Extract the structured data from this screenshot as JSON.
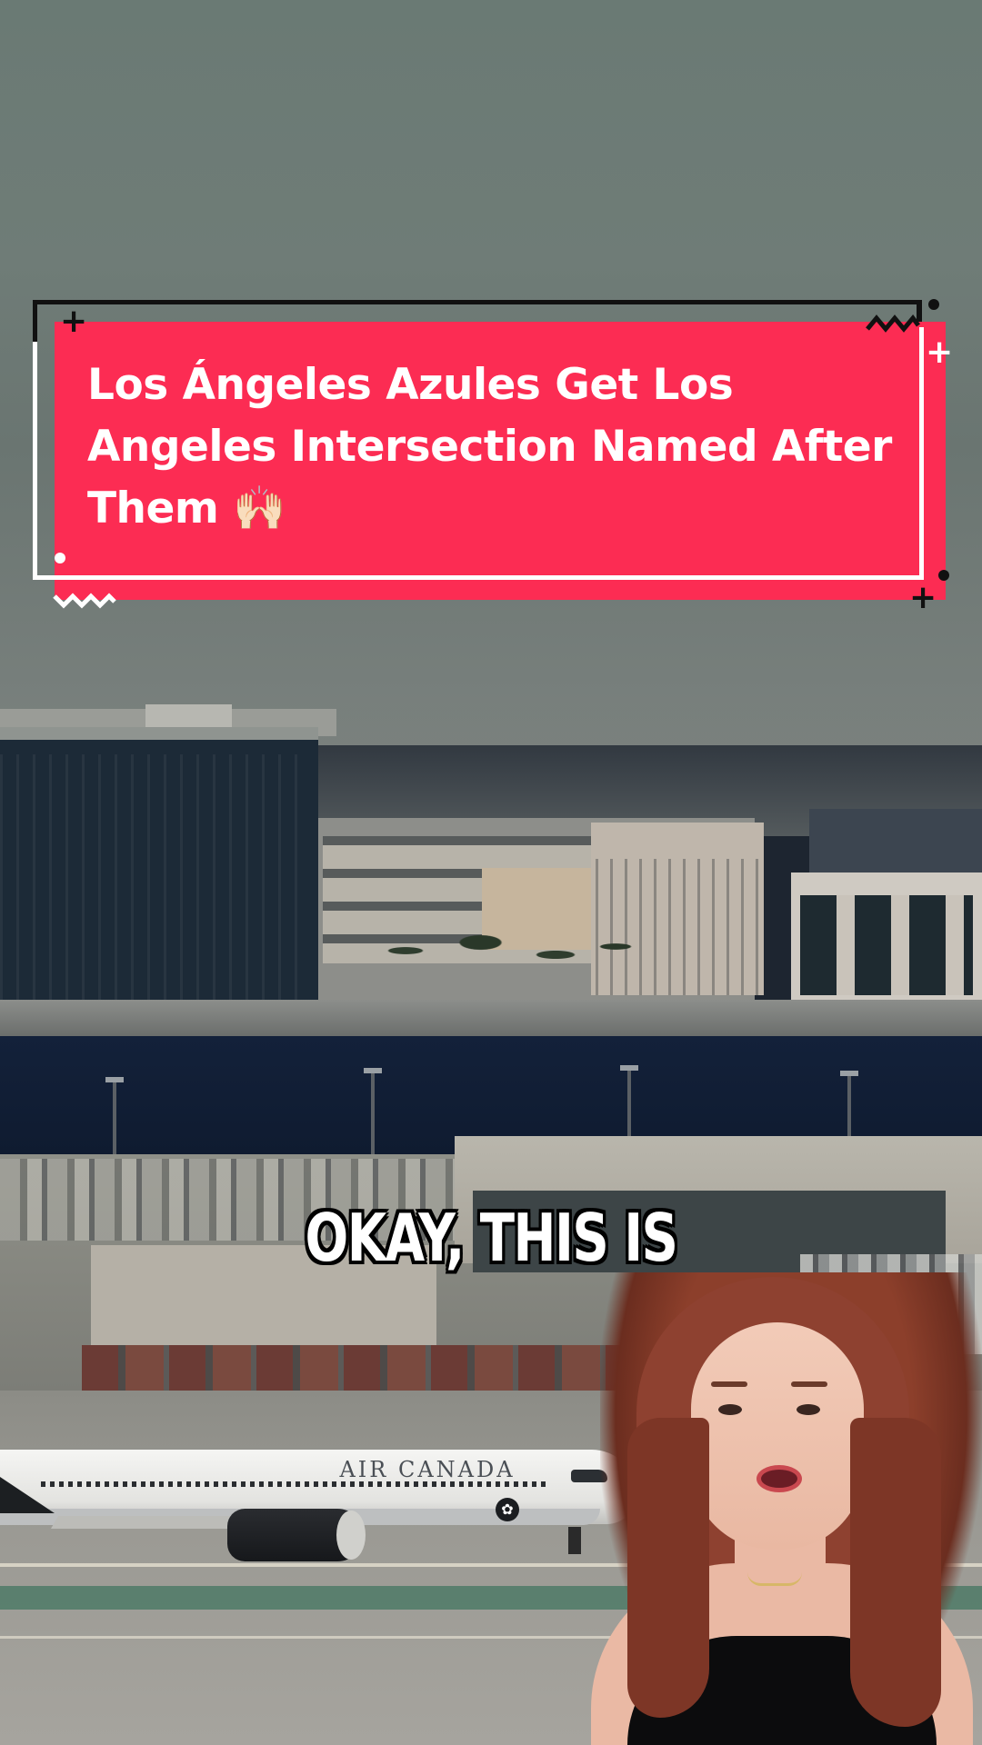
{
  "headline": {
    "text": "Los Ángeles Azules Get Los Angeles Intersection Named After Them 🙌🏻"
  },
  "caption": {
    "text": "OKAY, THIS IS"
  },
  "airplane": {
    "airline_text": "AIR CANADA",
    "logo_icon": "maple-leaf-icon"
  },
  "colors": {
    "banner_red": "#fc2c53",
    "banner_white": "#ffffff",
    "banner_black": "#111111",
    "caption_fill": "#ffffff",
    "caption_stroke": "#000000"
  },
  "decorations": {
    "plus_glyph": "+",
    "zigzag_glyph": "〰"
  }
}
